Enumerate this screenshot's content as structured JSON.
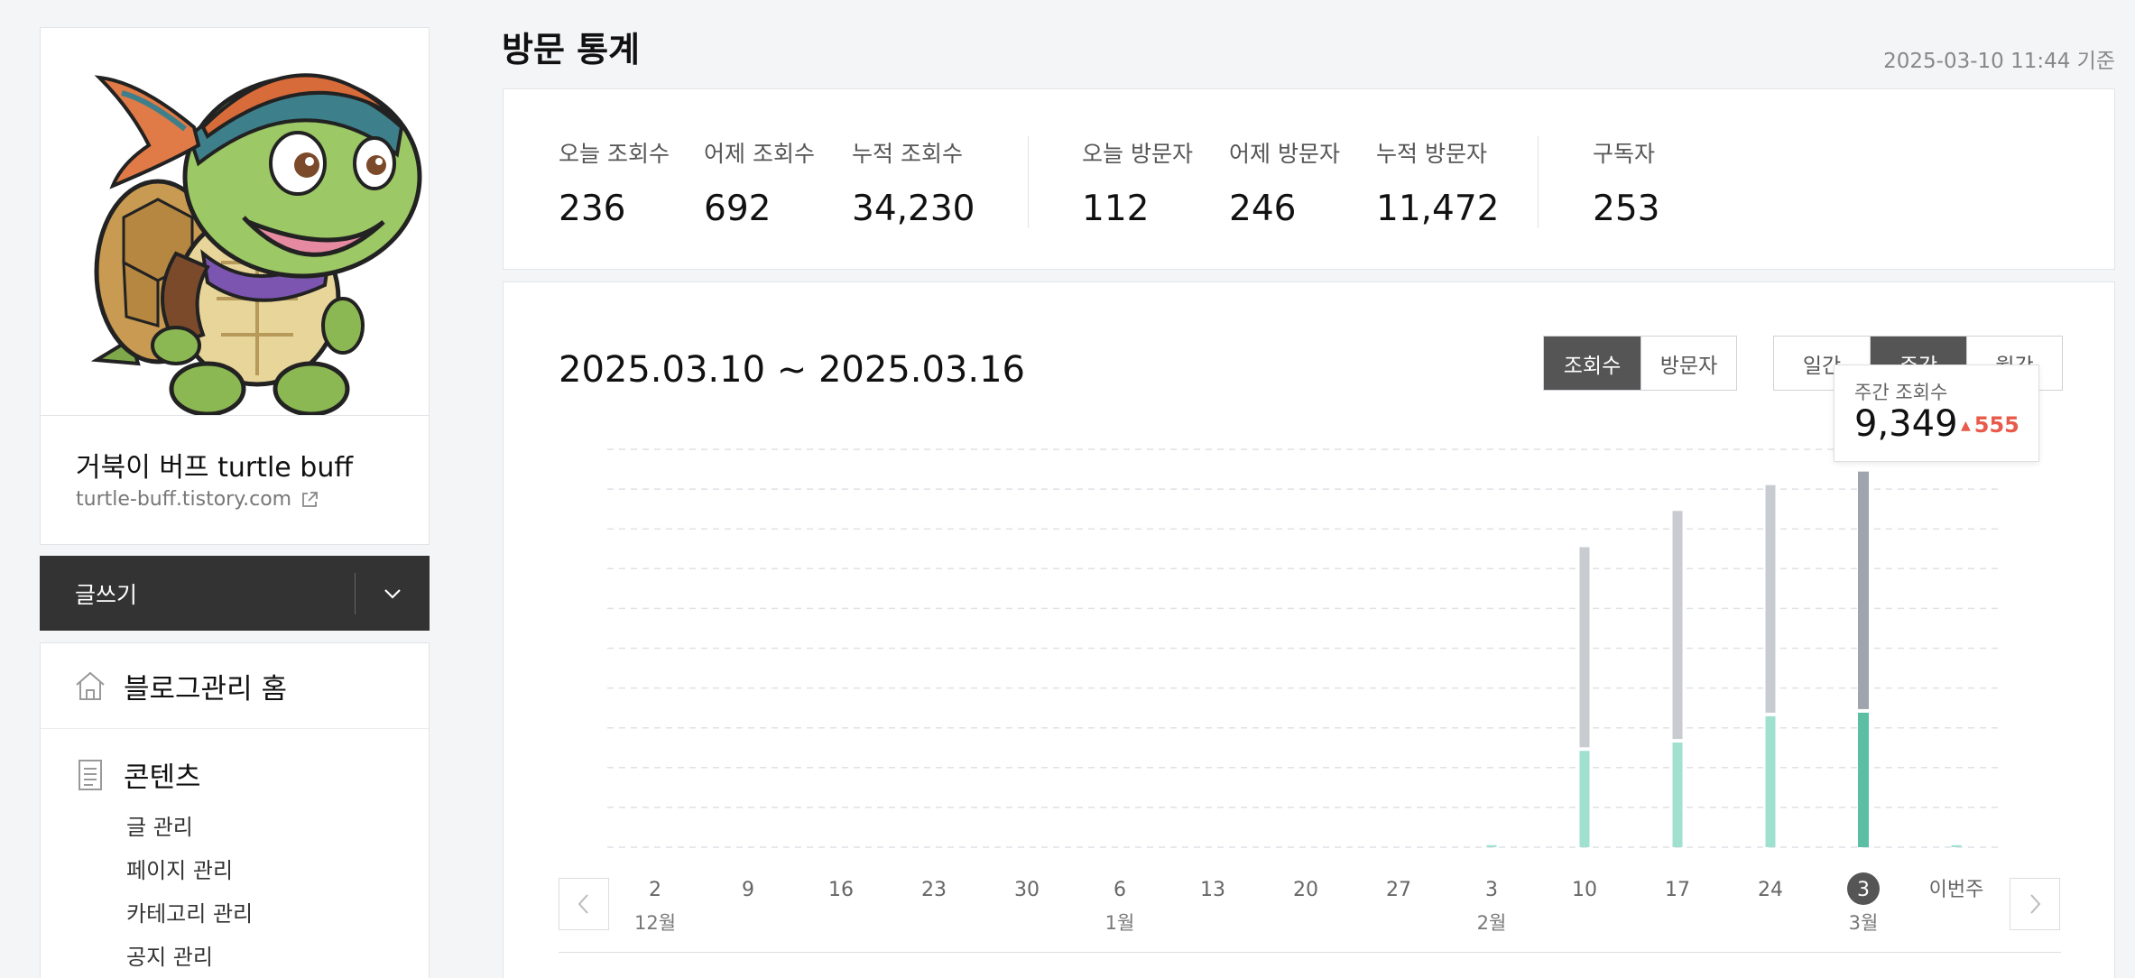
{
  "sidebar": {
    "blog_name": "거북이 버프 turtle buff",
    "blog_url": "turtle-buff.tistory.com",
    "write_label": "글쓰기",
    "menu_home": "블로그관리 홈",
    "menu_content": "콘텐츠",
    "submenu": [
      "글 관리",
      "페이지 관리",
      "카테고리 관리",
      "공지 관리"
    ]
  },
  "header": {
    "title": "방문 통계",
    "timestamp": "2025-03-10 11:44 기준"
  },
  "stats": [
    {
      "label": "오늘 조회수",
      "value": "236"
    },
    {
      "label": "어제 조회수",
      "value": "692"
    },
    {
      "label": "누적 조회수",
      "value": "34,230"
    },
    {
      "label": "오늘 방문자",
      "value": "112"
    },
    {
      "label": "어제 방문자",
      "value": "246"
    },
    {
      "label": "누적 방문자",
      "value": "11,472"
    },
    {
      "label": "구독자",
      "value": "253"
    }
  ],
  "chart_header": {
    "range": "2025.03.10 ~ 2025.03.16",
    "metric_tabs": [
      "조회수",
      "방문자"
    ],
    "active_metric": 0,
    "period_tabs": [
      "일간",
      "주간",
      "월간"
    ],
    "active_period": 1
  },
  "tooltip": {
    "label": "주간 조회수",
    "value": "9,349",
    "delta": "555"
  },
  "colors": {
    "bar_gray": "#c8cbd0",
    "bar_gray_active": "#a0a5ad",
    "bar_teal": "#9fe0cf",
    "bar_teal_active": "#5cbfa4",
    "delta_red": "#e85b4a",
    "active_tab": "#555555"
  },
  "chart_data": {
    "type": "bar",
    "stacked": true,
    "x": [
      "2",
      "9",
      "16",
      "23",
      "30",
      "6",
      "13",
      "20",
      "27",
      "3",
      "10",
      "17",
      "24",
      "3",
      "이번주"
    ],
    "month_labels": [
      {
        "index": 0,
        "label": "12월"
      },
      {
        "index": 5,
        "label": "1월"
      },
      {
        "index": 9,
        "label": "2월"
      },
      {
        "index": 13,
        "label": "3월"
      }
    ],
    "series": [
      {
        "values": [
          0,
          0,
          0,
          0,
          0,
          0,
          0,
          0,
          0,
          50,
          2420,
          2630,
          3290,
          3380,
          50
        ]
      },
      {
        "values": [
          0,
          0,
          0,
          0,
          0,
          0,
          0,
          0,
          0,
          0,
          5030,
          5730,
          5720,
          5970,
          0
        ]
      }
    ],
    "highlight_index": 13,
    "ylim": [
      0,
      10000
    ],
    "grid": true
  }
}
